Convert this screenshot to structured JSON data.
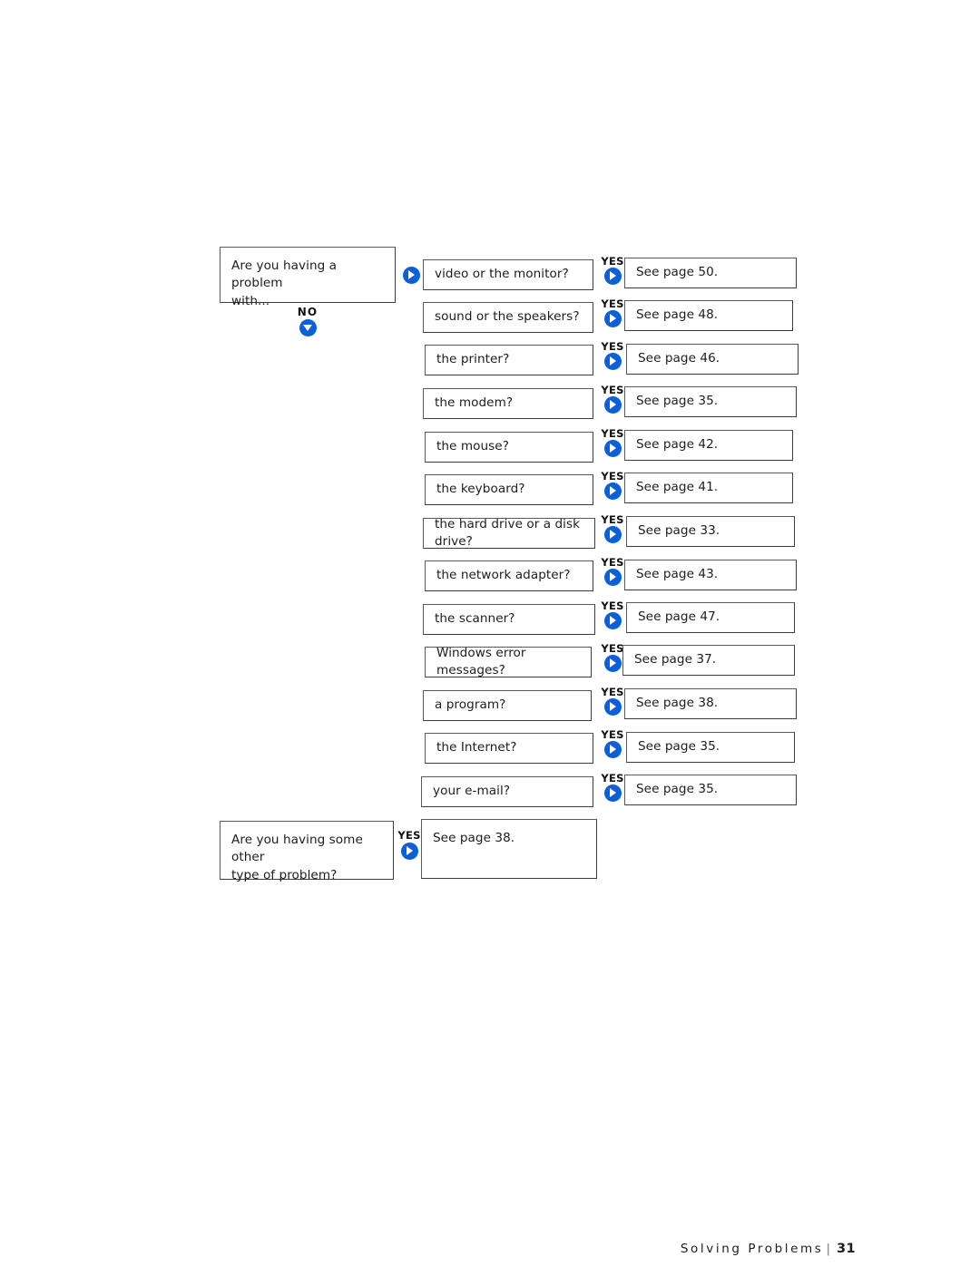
{
  "document": {
    "footer": {
      "section_title": "Solving Problems",
      "separator": "|",
      "page_number": "31"
    }
  },
  "flowchart": {
    "accent_color": "#0b5fd8",
    "start": {
      "text": "Are you having a problem with...",
      "line1": "Are you having a problem",
      "line2": "with...",
      "no_branch_label": "NO",
      "enter_arrow_label": ""
    },
    "yes_label": "YES",
    "branches": [
      {
        "question": "video or the monitor?",
        "answer_label": "YES",
        "result": "See page 50."
      },
      {
        "question": "sound or the speakers?",
        "answer_label": "YES",
        "result": "See page 48."
      },
      {
        "question": "the printer?",
        "answer_label": "YES",
        "result": "See page 46."
      },
      {
        "question": "the modem?",
        "answer_label": "YES",
        "result": "See page 35."
      },
      {
        "question": "the mouse?",
        "answer_label": "YES",
        "result": "See page 42."
      },
      {
        "question": "the keyboard?",
        "answer_label": "YES",
        "result": "See page 41."
      },
      {
        "question": "the hard drive or a disk drive?",
        "answer_label": "YES",
        "result": "See page 33."
      },
      {
        "question": "the network adapter?",
        "answer_label": "YES",
        "result": "See page 43."
      },
      {
        "question": "the scanner?",
        "answer_label": "YES",
        "result": "See page 47."
      },
      {
        "question": "Windows error messages?",
        "answer_label": "YES",
        "result": "See page 37."
      },
      {
        "question": "a program?",
        "answer_label": "YES",
        "result": "See page 38."
      },
      {
        "question": "the Internet?",
        "answer_label": "YES",
        "result": "See page 35."
      },
      {
        "question": "your e-mail?",
        "answer_label": "YES",
        "result": "See page 35."
      }
    ],
    "other": {
      "line1": "Are you having some other",
      "line2": "type of problem?",
      "answer_label": "YES",
      "result": "See page 38."
    }
  }
}
